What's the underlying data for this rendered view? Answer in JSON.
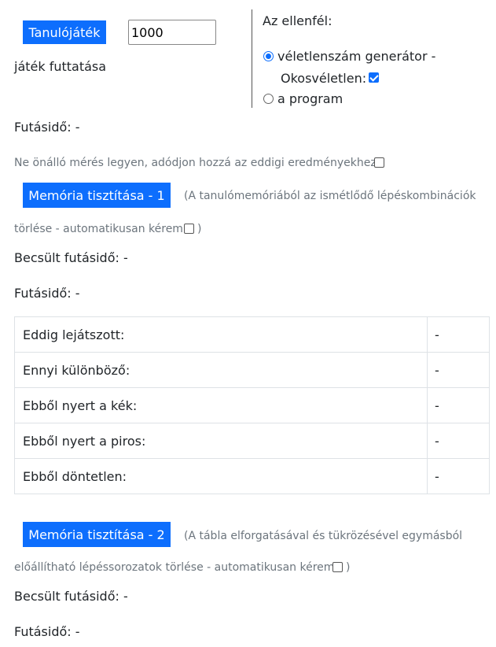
{
  "learn_game": {
    "button_label": "Tanulójáték",
    "games_input_value": "1000",
    "run_games_label": "játék futtatása",
    "runtime_label": "Futásidő: -"
  },
  "opponent": {
    "title": "Az ellenfél:",
    "random_label": "véletlenszám generátor -",
    "smart_random_label": "Okosvéletlen:",
    "program_label": "a program"
  },
  "accumulate": {
    "label": "Ne önálló mérés legyen, adódjon hozzá az eddigi eredményekhez"
  },
  "memory1": {
    "button_label": "Memória tisztítása - 1",
    "desc_line1": "(A tanulómemóriából az ismétlődő lépéskombinációk",
    "desc_line2": "törlése - automatikusan kérem",
    "desc_close": ")",
    "estimated_label": "Becsült futásidő: -",
    "runtime_label": "Futásidő: -"
  },
  "stats": {
    "rows": [
      {
        "label": "Eddig lejátszott:",
        "value": "-"
      },
      {
        "label": "Ennyi különböző:",
        "value": "-"
      },
      {
        "label": "Ebből nyert a kék:",
        "value": "-"
      },
      {
        "label": "Ebből nyert a piros:",
        "value": "-"
      },
      {
        "label": "Ebből döntetlen:",
        "value": "-"
      }
    ]
  },
  "memory2": {
    "button_label": "Memória tisztítása - 2",
    "desc_line1": "(A tábla elforgatásával és tükrözésével egymásból",
    "desc_line2": "előállítható lépéssorozatok törlése - automatikusan kérem",
    "desc_close": ")",
    "estimated_label": "Becsült futásidő: -",
    "runtime_label": "Futásidő: -"
  },
  "colors": {
    "primary": "#0d6efd",
    "text": "#212529",
    "muted": "#6c757d"
  }
}
